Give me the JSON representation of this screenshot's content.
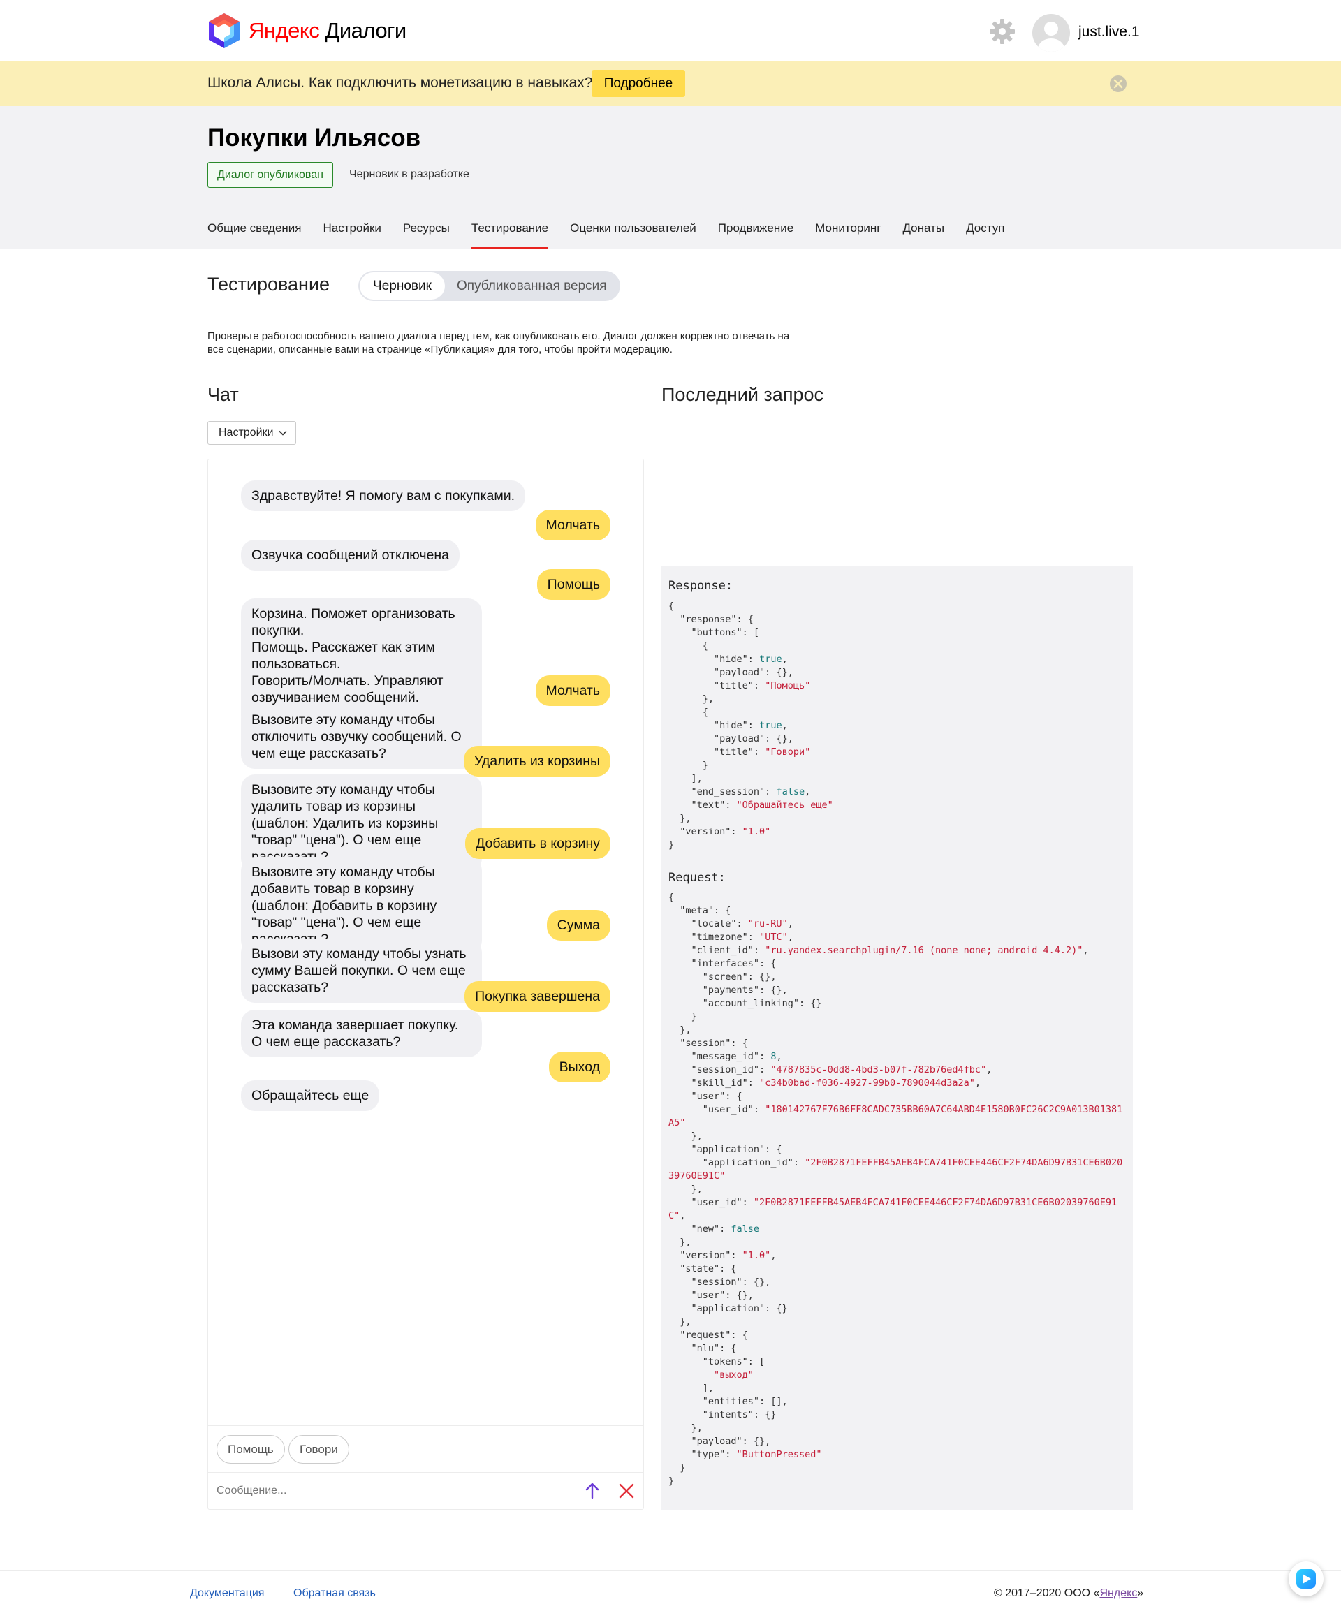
{
  "header": {
    "brand_prefix": "Яндекс",
    "brand_suffix": " Диалоги",
    "username": "just.live.1"
  },
  "banner": {
    "text": "Школа Алисы. Как подключить монетизацию в навыках?",
    "button": "Подробнее"
  },
  "skill": {
    "title": "Покупки Ильясов",
    "status_published": "Диалог опубликован",
    "status_draft": "Черновик в разработке"
  },
  "tabs": [
    {
      "label": "Общие сведения"
    },
    {
      "label": "Настройки"
    },
    {
      "label": "Ресурсы"
    },
    {
      "label": "Тестирование"
    },
    {
      "label": "Оценки пользователей"
    },
    {
      "label": "Продвижение"
    },
    {
      "label": "Мониторинг"
    },
    {
      "label": "Донаты"
    },
    {
      "label": "Доступ"
    }
  ],
  "testing": {
    "title": "Тестирование",
    "switch_draft": "Черновик",
    "switch_published": "Опубликованная версия",
    "description": "Проверьте работоспособность вашего диалога перед тем, как опубликовать его. Диалог должен корректно отвечать на все сценарии, описанные вами на странице «Публикация» для того, чтобы пройти модерацию."
  },
  "chat": {
    "title": "Чат",
    "settings_label": "Настройки",
    "messages": [
      {
        "from": "bot",
        "text": "Здравствуйте! Я помогу вам с покупками."
      },
      {
        "from": "user",
        "text": "Молчать"
      },
      {
        "from": "bot",
        "text": "Озвучка сообщений отключена"
      },
      {
        "from": "user",
        "text": "Помощь"
      },
      {
        "from": "bot",
        "text": "Корзина. Поможет организовать покупки.\nПомощь. Расскажет как этим пользоваться.\nГоворить/Молчать. Управляют озвучиванием сообщений.\nО чём рассказать подробнее?"
      },
      {
        "from": "user",
        "text": "Молчать"
      },
      {
        "from": "bot",
        "text": "Вызовите эту команду чтобы отключить озвучку сообщений. О чем еще рассказать?"
      },
      {
        "from": "user",
        "text": "Удалить из корзины"
      },
      {
        "from": "bot",
        "text": "Вызовите эту команду чтобы удалить товар из корзины (шаблон: Удалить из корзины \"товар\" \"цена\"). О чем еще рассказать?"
      },
      {
        "from": "user",
        "text": "Добавить в корзину"
      },
      {
        "from": "bot",
        "text": "Вызовите эту команду чтобы добавить товар в корзину (шаблон: Добавить в корзину \"товар\" \"цена\"). О чем еще рассказать?"
      },
      {
        "from": "user",
        "text": "Сумма"
      },
      {
        "from": "bot",
        "text": "Вызови эту команду чтобы узнать сумму Вашей покупки. О чем еще рассказать?"
      },
      {
        "from": "user",
        "text": "Покупка завершена"
      },
      {
        "from": "bot",
        "text": "Эта команда завершает покупку. О чем еще рассказать?"
      },
      {
        "from": "user",
        "text": "Выход"
      },
      {
        "from": "bot",
        "text": "Обращайтесь еще"
      }
    ],
    "suggestions": [
      "Помощь",
      "Говори"
    ],
    "input_placeholder": "Сообщение..."
  },
  "last_request": {
    "title": "Последний запрос",
    "response_label": "Response:",
    "request_label": "Request:"
  },
  "footer": {
    "docs": "Документация",
    "feedback": "Обратная связь",
    "copyright_prefix": "© 2017–2020  ООО «",
    "copyright_link": "Яндекс",
    "copyright_suffix": "»"
  },
  "colors": {
    "accent_yellow": "#ffdb4d",
    "tab_underline": "#e8231f",
    "published_green": "#1f7a1f",
    "json_string": "#c4203a",
    "json_literal": "#1a7a7a",
    "link_blue": "#1f5bb8"
  }
}
